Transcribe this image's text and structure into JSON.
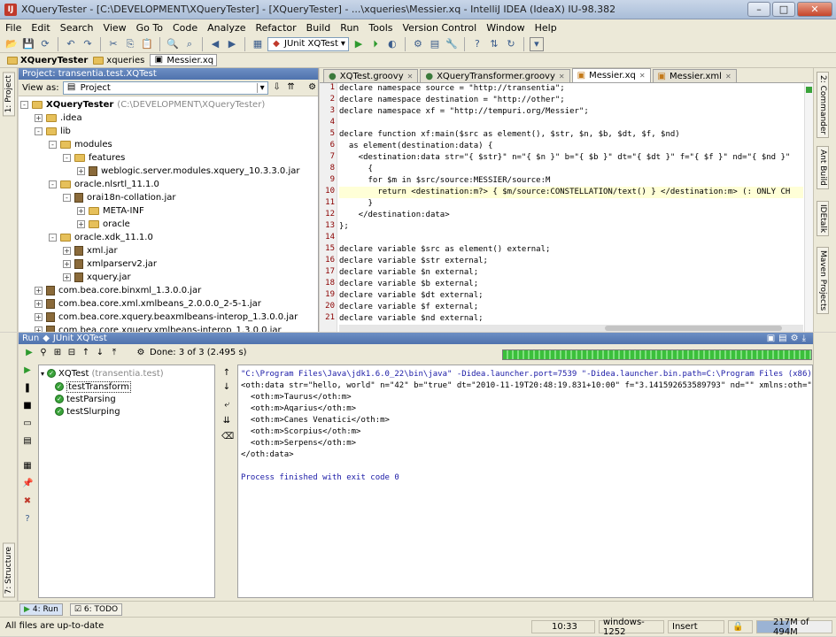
{
  "window": {
    "title": "XQueryTester - [C:\\DEVELOPMENT\\XQueryTester] - [XQueryTester] - ...\\xqueries\\Messier.xq - IntelliJ IDEA (IdeaX) IU-98.382"
  },
  "menu": [
    "File",
    "Edit",
    "Search",
    "View",
    "Go To",
    "Code",
    "Analyze",
    "Refactor",
    "Build",
    "Run",
    "Tools",
    "Version Control",
    "Window",
    "Help"
  ],
  "toolbar": {
    "run_config": "JUnit XQTest"
  },
  "breadcrumbs": [
    "XQueryTester",
    "xqueries",
    "Messier.xq"
  ],
  "side_tabs": {
    "left_project": "1: Project",
    "left_structure": "7: Structure",
    "right": [
      "2: Commander",
      "Ant Build",
      "IDEtalk",
      "Maven Projects"
    ]
  },
  "project": {
    "header": "Project: transentia.test.XQTest",
    "view_as_label": "View as:",
    "view_as_value": "Project",
    "tree": [
      {
        "label": "XQueryTester",
        "extra": "(C:\\DEVELOPMENT\\XQueryTester)",
        "bold": true
      },
      {
        "label": ".idea"
      },
      {
        "label": "lib"
      },
      {
        "label": "modules"
      },
      {
        "label": "features"
      },
      {
        "label": "weblogic.server.modules.xquery_10.3.3.0.jar"
      },
      {
        "label": "oracle.nlsrtl_11.1.0"
      },
      {
        "label": "orai18n-collation.jar"
      },
      {
        "label": "META-INF"
      },
      {
        "label": "oracle"
      },
      {
        "label": "oracle.xdk_11.1.0"
      },
      {
        "label": "xml.jar"
      },
      {
        "label": "xmlparserv2.jar"
      },
      {
        "label": "xquery.jar"
      },
      {
        "label": "com.bea.core.binxml_1.3.0.0.jar"
      },
      {
        "label": "com.bea.core.xml.xmlbeans_2.0.0.0_2-5-1.jar"
      },
      {
        "label": "com.bea.core.xquery.beaxmlbeans-interop_1.3.0.0.jar"
      },
      {
        "label": "com.bea.core.xquery.xmlbeans-interop_1.3.0.0.jar"
      }
    ]
  },
  "editor": {
    "tabs": [
      "XQTest.groovy",
      "XQueryTransformer.groovy",
      "Messier.xq",
      "Messier.xml"
    ],
    "active_tab": "Messier.xq",
    "lines": [
      "declare namespace source = \"http://transentia\";",
      "declare namespace destination = \"http://other\";",
      "declare namespace xf = \"http://tempuri.org/Messier\";",
      "",
      "declare function xf:main($src as element(), $str, $n, $b, $dt, $f, $nd)",
      "  as element(destination:data) {",
      "    <destination:data str=\"{ $str}\" n=\"{ $n }\" b=\"{ $b }\" dt=\"{ $dt }\" f=\"{ $f }\" nd=\"{ $nd }\"",
      "      {",
      "      for $m in $src/source:MESSIER/source:M",
      "        return <destination:m?> { $m/source:CONSTELLATION/text() } </destination:m> (: ONLY CH",
      "      }",
      "    </destination:data>",
      "};",
      "",
      "declare variable $src as element() external;",
      "declare variable $str external;",
      "declare variable $n external;",
      "declare variable $b external;",
      "declare variable $dt external;",
      "declare variable $f external;",
      "declare variable $nd external;"
    ]
  },
  "run": {
    "header": "Run",
    "config": "JUnit XQTest",
    "done_text": "Done: 3 of 3 (2.495 s)",
    "tests": {
      "suite": "XQTest",
      "suite_pkg": "(transentia.test)",
      "cases": [
        "testTransform",
        "testParsing",
        "testSlurping"
      ]
    },
    "console": [
      "\"C:\\Program Files\\Java\\jdk1.6.0_22\\bin\\java\" -Didea.launcher.port=7539 \"-Didea.launcher.bin.path=C:\\Program Files (x86)\\JetBr",
      "<oth:data str=\"hello, world\" n=\"42\" b=\"true\" dt=\"2010-11-19T20:48:19.831+10:00\" f=\"3.141592653589793\" nd=\"\" xmlns:oth=\"http:/",
      "  <oth:m>Taurus</oth:m>",
      "  <oth:m>Aqarius</oth:m>",
      "  <oth:m>Canes Venatici</oth:m>",
      "  <oth:m>Scorpius</oth:m>",
      "  <oth:m>Serpens</oth:m>",
      "</oth:data>",
      "",
      "Process finished with exit code 0"
    ]
  },
  "bottom_tabs": [
    "4: Run",
    "6: TODO"
  ],
  "status": {
    "message": "All files are up-to-date",
    "position": "10:33",
    "encoding": "windows-1252",
    "mode": "Insert",
    "memory": "217M of 494M"
  },
  "colors": {
    "accent": "#4f72ad",
    "keyword": "#000080",
    "string": "#008000",
    "console_blue": "#1a1aa6",
    "progress": "#3bbf3b"
  }
}
